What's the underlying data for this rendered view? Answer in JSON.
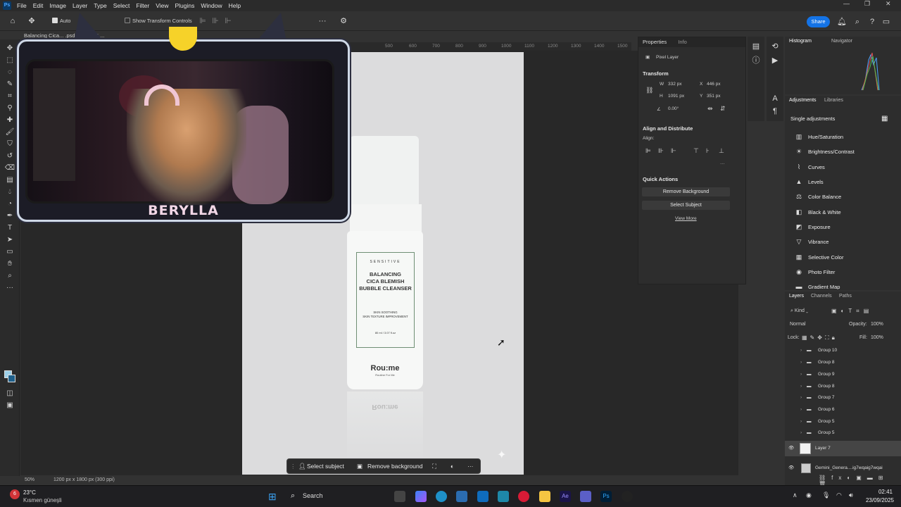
{
  "app": {
    "logo": "Ps",
    "menu": [
      "File",
      "Edit",
      "Image",
      "Layer",
      "Type",
      "Select",
      "Filter",
      "View",
      "Plugins",
      "Window",
      "Help"
    ]
  },
  "options_bar": {
    "auto_select_label": "Auto",
    "show_transform_controls": "Show Transform Controls",
    "share_label": "Share"
  },
  "document": {
    "tab_title": "Balancing Cica... .psd @ 50% (L...",
    "ruler_ticks": [
      "500",
      "600",
      "700",
      "800",
      "900",
      "1000",
      "1100",
      "1200",
      "1300",
      "1400",
      "1500",
      "1600"
    ],
    "zoom": "50%",
    "doc_size": "1200 px x 1800 px (300 ppi)"
  },
  "product": {
    "label_top": "SENSITIVE",
    "label_title": "BALANCING\nCICA BLEMISH\nBUBBLE CLEANSER",
    "label_sub": "SKIN SOOTHING\nSKIN TEXTURE IMPROVEMENT",
    "label_volume": "80 ml / 3.07 fl.oz",
    "brand": "Rou:me",
    "brand_sub": "Routine For Me"
  },
  "context_bar": {
    "select_subject": "Select subject",
    "remove_background": "Remove background"
  },
  "stream_overlay": {
    "name": "BERYLLA"
  },
  "properties": {
    "tabs": [
      "Properties",
      "Info"
    ],
    "layer_type": "Pixel Layer",
    "transform_title": "Transform",
    "w_label": "W",
    "w": "332 px",
    "h_label": "H",
    "h": "1091 px",
    "x_label": "X",
    "x": "446 px",
    "y_label": "Y",
    "y": "351 px",
    "angle": "0.00°",
    "align_title": "Align and Distribute",
    "align_label": "Align:",
    "quick_actions_title": "Quick Actions",
    "remove_background": "Remove Background",
    "select_subject": "Select Subject",
    "view_more": "View More"
  },
  "histogram": {
    "tabs": [
      "Histogram",
      "Navigator"
    ]
  },
  "adjustments": {
    "tabs": [
      "Adjustments",
      "Libraries"
    ],
    "section": "Single adjustments",
    "items": [
      "Hue/Saturation",
      "Brightness/Contrast",
      "Curves",
      "Levels",
      "Color Balance",
      "Black & White",
      "Exposure",
      "Vibrance",
      "Selective Color",
      "Photo Filter",
      "Gradient Map"
    ]
  },
  "layers": {
    "tabs": [
      "Layers",
      "Channels",
      "Paths"
    ],
    "kind": "Kind",
    "blend": "Normal",
    "opacity_label": "Opacity:",
    "opacity": "100%",
    "lock_label": "Lock:",
    "fill_label": "Fill:",
    "fill": "100%",
    "rows": [
      "Group 10",
      "Group 8",
      "Group 9",
      "Group 8",
      "Group 7",
      "Group 6",
      "Group 5",
      "Group 5"
    ],
    "layer7": "Layer 7",
    "gemini": "Gemini_Genera....ig7wqaig7wqai"
  },
  "taskbar": {
    "weather_temp": "23°C",
    "weather_desc": "Kısmen güneşli",
    "search": "Search",
    "time": "02:41",
    "date": "23/09/2025",
    "notif_badge": "6"
  }
}
